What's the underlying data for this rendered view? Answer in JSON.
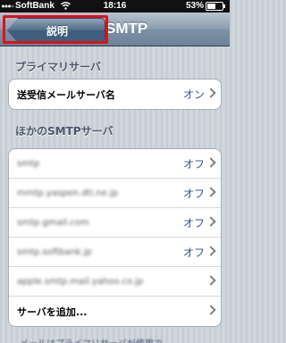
{
  "status_bar": {
    "carrier": "SoftBank",
    "time": "18:16",
    "battery": "53%"
  },
  "nav": {
    "title": "SMTP",
    "back_label": "説明"
  },
  "primary_section": {
    "header": "プライマリサーバ",
    "rows": [
      {
        "label": "送受信メールサーバ名",
        "value": "オン"
      }
    ]
  },
  "other_section": {
    "header": "ほかのSMTPサーバ",
    "rows": [
      {
        "label": "smtp",
        "value": "オフ"
      },
      {
        "label": "mmtp.yaspen.dti.ne.jp",
        "value": "オフ"
      },
      {
        "label": "smtp.gmail.com",
        "value": "オフ"
      },
      {
        "label": "smtp.softbank.jp",
        "value": "オフ"
      },
      {
        "label": "apple.smtp.mail.yahoo.co.jp",
        "value": ""
      },
      {
        "label": "サーバを追加...",
        "value": ""
      }
    ]
  },
  "footer": "メールはプライマリサーバが使用で"
}
